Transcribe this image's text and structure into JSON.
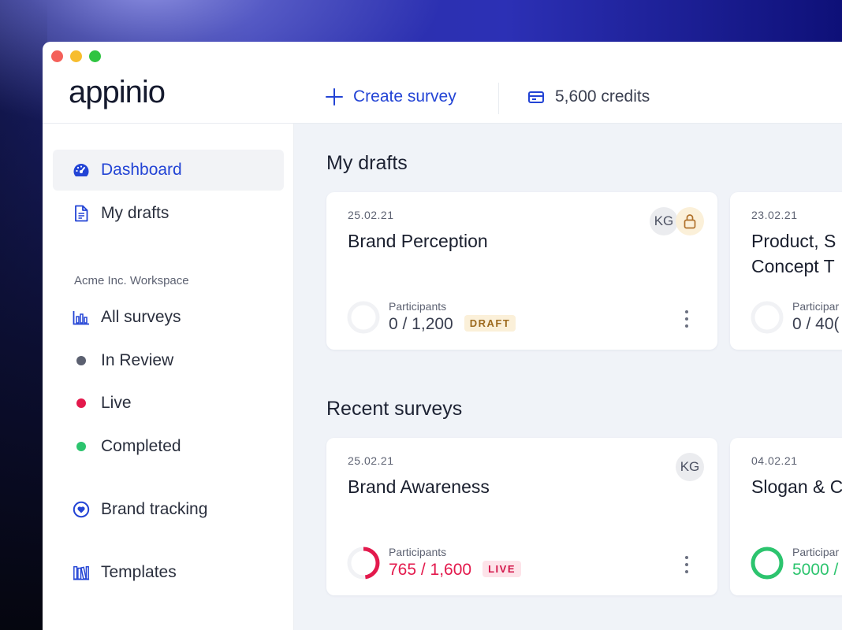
{
  "app": {
    "logo": "appinio"
  },
  "header": {
    "create_label": "Create survey",
    "credits_label": "5,600 credits"
  },
  "sidebar": {
    "items_top": [
      {
        "label": "Dashboard",
        "icon": "dashboard-icon",
        "active": true
      },
      {
        "label": "My drafts",
        "icon": "document-icon"
      }
    ],
    "workspace_label": "Acme Inc. Workspace",
    "items_workspace": [
      {
        "label": "All surveys",
        "icon": "bar-chart-icon"
      },
      {
        "label": "In Review",
        "icon": "status-dot",
        "color": "#5b6070"
      },
      {
        "label": "Live",
        "icon": "status-dot",
        "color": "#e3194c"
      },
      {
        "label": "Completed",
        "icon": "status-dot",
        "color": "#2cc46e"
      }
    ],
    "brand_tracking": {
      "label": "Brand tracking",
      "icon": "heart-circle-icon"
    },
    "templates": {
      "label": "Templates",
      "icon": "templates-icon"
    }
  },
  "main": {
    "drafts_title": "My drafts",
    "recent_title": "Recent surveys",
    "drafts": [
      {
        "date": "25.02.21",
        "title": "Brand Perception",
        "participants_label": "Participants",
        "participants": "0 / 1,200",
        "progress": 0,
        "badge": "DRAFT",
        "avatar": "KG",
        "locked": true
      },
      {
        "date": "23.02.21",
        "title": "Product, S Concept T",
        "participants_label": "Participar",
        "participants": "0 / 40(",
        "progress": 0
      }
    ],
    "recent": [
      {
        "date": "25.02.21",
        "title": "Brand Awareness",
        "participants_label": "Participants",
        "participants": "765 / 1,600",
        "progress": 0.478,
        "badge": "LIVE",
        "avatar": "KG",
        "color": "#e3194c"
      },
      {
        "date": "04.02.21",
        "title": "Slogan & C",
        "participants_label": "Participar",
        "participants": "5000 /",
        "progress": 1,
        "color": "#2cc46e"
      }
    ]
  }
}
